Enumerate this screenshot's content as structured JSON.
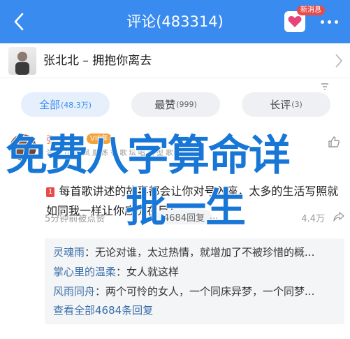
{
  "header": {
    "title": "评论(483314)",
    "new_badge": "新消息"
  },
  "song": {
    "title": "张北北 – 拥抱你离去"
  },
  "tabs": [
    {
      "label": "全部",
      "count": "(48.3万)",
      "active": true
    },
    {
      "label": "最赞",
      "count": "(999)",
      "active": false
    },
    {
      "label": "长评",
      "count": "(3)",
      "active": false
    }
  ],
  "comment": {
    "user_name": "张",
    "vip_badge": "VIP年",
    "user_sub": "演 歌 小 贝 凤 凰 炼 行 歌 坛 唱 实 型 歌 手 歌 品",
    "tag": "1",
    "text": "每首歌讲述的故事都会让你对号入座，太多的生活写照就如同我一样让你应历在目！",
    "time": "5分钟前被点赞",
    "reply_count": "4684回复",
    "more": "...",
    "views": "4.4万"
  },
  "replies": [
    {
      "name": "灵魂雨",
      "text": "无论对谁，太过热情，就增加了不被珍惜的概..."
    },
    {
      "name": "掌心里的温柔",
      "text": "女人就这样"
    },
    {
      "name": "风雨同舟",
      "text": "两个可怜的女人，一个同床异梦，一个同梦..."
    }
  ],
  "view_all": "查看全部4684条回复",
  "overlay": {
    "line1": "免费八字算命详",
    "line2": "批一生"
  },
  "colors": {
    "header_bg": "#3a8bf0",
    "accent": "#3a8bf0",
    "overlay": "#1877d6",
    "reply_name": "#3a6ea8"
  }
}
